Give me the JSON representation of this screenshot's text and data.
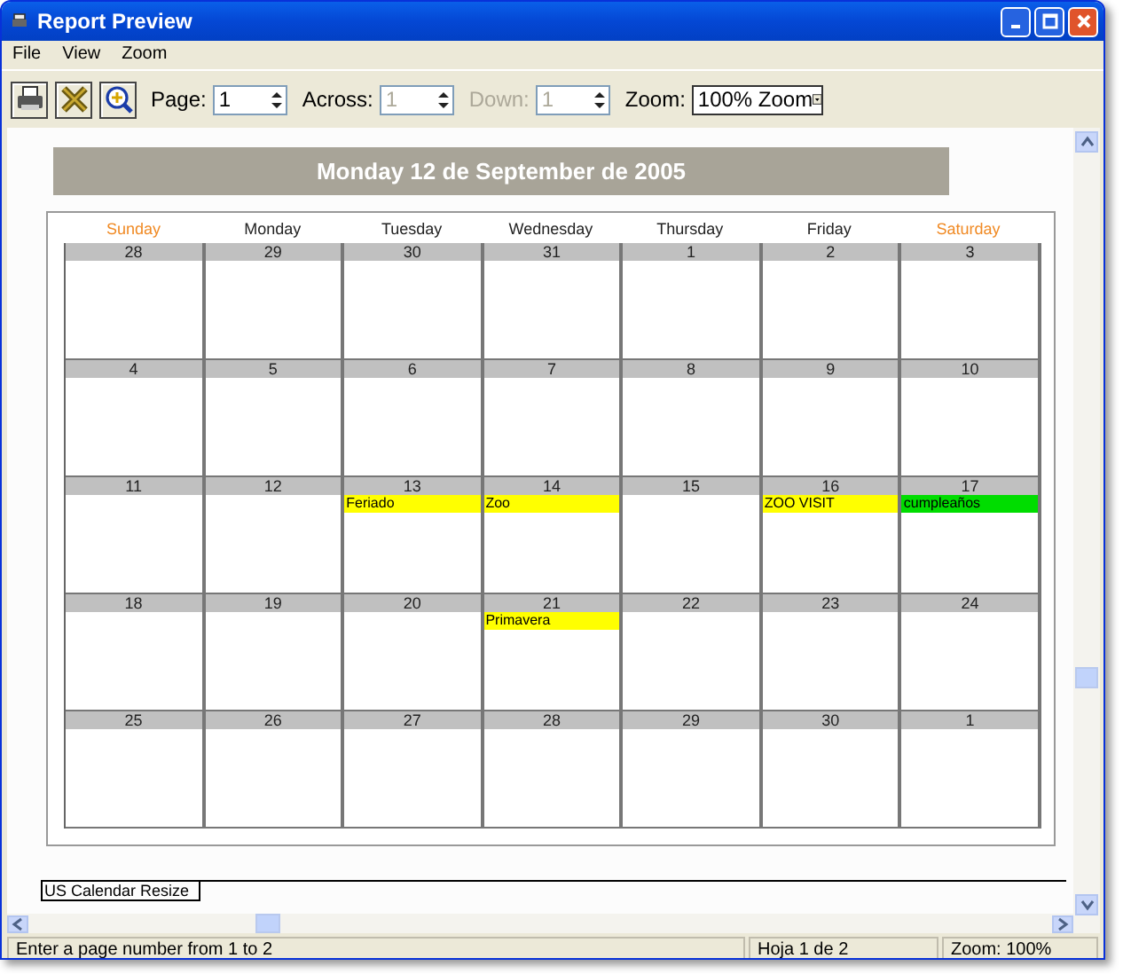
{
  "window": {
    "title": "Report Preview"
  },
  "menu": [
    "File",
    "View",
    "Zoom"
  ],
  "toolbar": {
    "fields": [
      {
        "label": "Page:",
        "value": "1",
        "disabled": false,
        "label_disabled": false
      },
      {
        "label": "Across:",
        "value": "1",
        "disabled": true,
        "label_disabled": false
      },
      {
        "label": "Down:",
        "value": "1",
        "disabled": true,
        "label_disabled": true
      }
    ],
    "zoom": {
      "label": "Zoom:",
      "value": "100% Zoom"
    }
  },
  "report": {
    "heading": "Monday 12 de September de 2005",
    "day_names": [
      {
        "name": "Sunday",
        "weekend": true
      },
      {
        "name": "Monday",
        "weekend": false
      },
      {
        "name": "Tuesday",
        "weekend": false
      },
      {
        "name": "Wednesday",
        "weekend": false
      },
      {
        "name": "Thursday",
        "weekend": false
      },
      {
        "name": "Friday",
        "weekend": false
      },
      {
        "name": "Saturday",
        "weekend": true
      }
    ],
    "weeks": [
      [
        {
          "day": "28"
        },
        {
          "day": "29"
        },
        {
          "day": "30"
        },
        {
          "day": "31"
        },
        {
          "day": "1"
        },
        {
          "day": "2"
        },
        {
          "day": "3"
        }
      ],
      [
        {
          "day": "4"
        },
        {
          "day": "5"
        },
        {
          "day": "6"
        },
        {
          "day": "7"
        },
        {
          "day": "8"
        },
        {
          "day": "9"
        },
        {
          "day": "10"
        }
      ],
      [
        {
          "day": "11"
        },
        {
          "day": "12"
        },
        {
          "day": "13",
          "events": [
            {
              "text": "Feriado",
              "color": "#ffff00"
            }
          ]
        },
        {
          "day": "14",
          "events": [
            {
              "text": "Zoo",
              "color": "#ffff00"
            }
          ]
        },
        {
          "day": "15"
        },
        {
          "day": "16",
          "events": [
            {
              "text": "ZOO VISIT",
              "color": "#ffff00"
            }
          ]
        },
        {
          "day": "17",
          "events": [
            {
              "text": "cumpleaños",
              "color": "#00dd00"
            }
          ]
        }
      ],
      [
        {
          "day": "18"
        },
        {
          "day": "19"
        },
        {
          "day": "20"
        },
        {
          "day": "21",
          "events": [
            {
              "text": "Primavera",
              "color": "#ffff00"
            }
          ]
        },
        {
          "day": "22"
        },
        {
          "day": "23"
        },
        {
          "day": "24"
        }
      ],
      [
        {
          "day": "25"
        },
        {
          "day": "26"
        },
        {
          "day": "27"
        },
        {
          "day": "28"
        },
        {
          "day": "29"
        },
        {
          "day": "30"
        },
        {
          "day": "1"
        }
      ]
    ],
    "footer": "US Calendar Resize"
  },
  "status_bar": [
    "Enter a page number from 1 to 2",
    "Hoja 1 de 2",
    "Zoom: 100%"
  ]
}
